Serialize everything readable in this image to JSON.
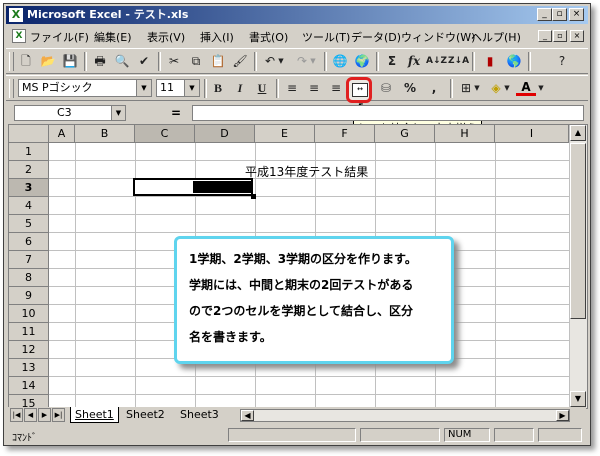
{
  "window": {
    "title": "Microsoft Excel - テスト.xls",
    "app_icon": "X"
  },
  "menu": {
    "items": [
      "ファイル(F)",
      "編集(E)",
      "表示(V)",
      "挿入(I)",
      "書式(O)",
      "ツール(T)",
      "データ(D)",
      "ウィンドウ(W)",
      "ヘルプ(H)"
    ]
  },
  "format_toolbar": {
    "font_name": "MS Pゴシック",
    "font_size": "11",
    "bold": "B",
    "italic": "I",
    "underline": "U",
    "percent": "%",
    "comma": ","
  },
  "tooltip": "セルを結合して中央揃え",
  "formula_bar": {
    "name_box": "C3",
    "equals": "=",
    "content": ""
  },
  "sheet": {
    "columns": [
      "A",
      "B",
      "C",
      "D",
      "E",
      "F",
      "G",
      "H",
      "I"
    ],
    "rows": [
      "1",
      "2",
      "3",
      "4",
      "5",
      "6",
      "7",
      "8",
      "9",
      "10",
      "11",
      "12",
      "13",
      "14",
      "15"
    ],
    "title_cell_text": "平成13年度テスト結果"
  },
  "callout": {
    "lines": [
      "1学期、2学期、3学期の区分を作ります。",
      "学期には、中間と期末の2回テストがある",
      "ので2つのセルを学期として結合し、区分",
      "名を書きます。"
    ]
  },
  "sheet_tabs": [
    "Sheet1",
    "Sheet2",
    "Sheet3"
  ],
  "status": {
    "mode": "ｺﾏﾝﾄﾞ",
    "num": "NUM"
  }
}
